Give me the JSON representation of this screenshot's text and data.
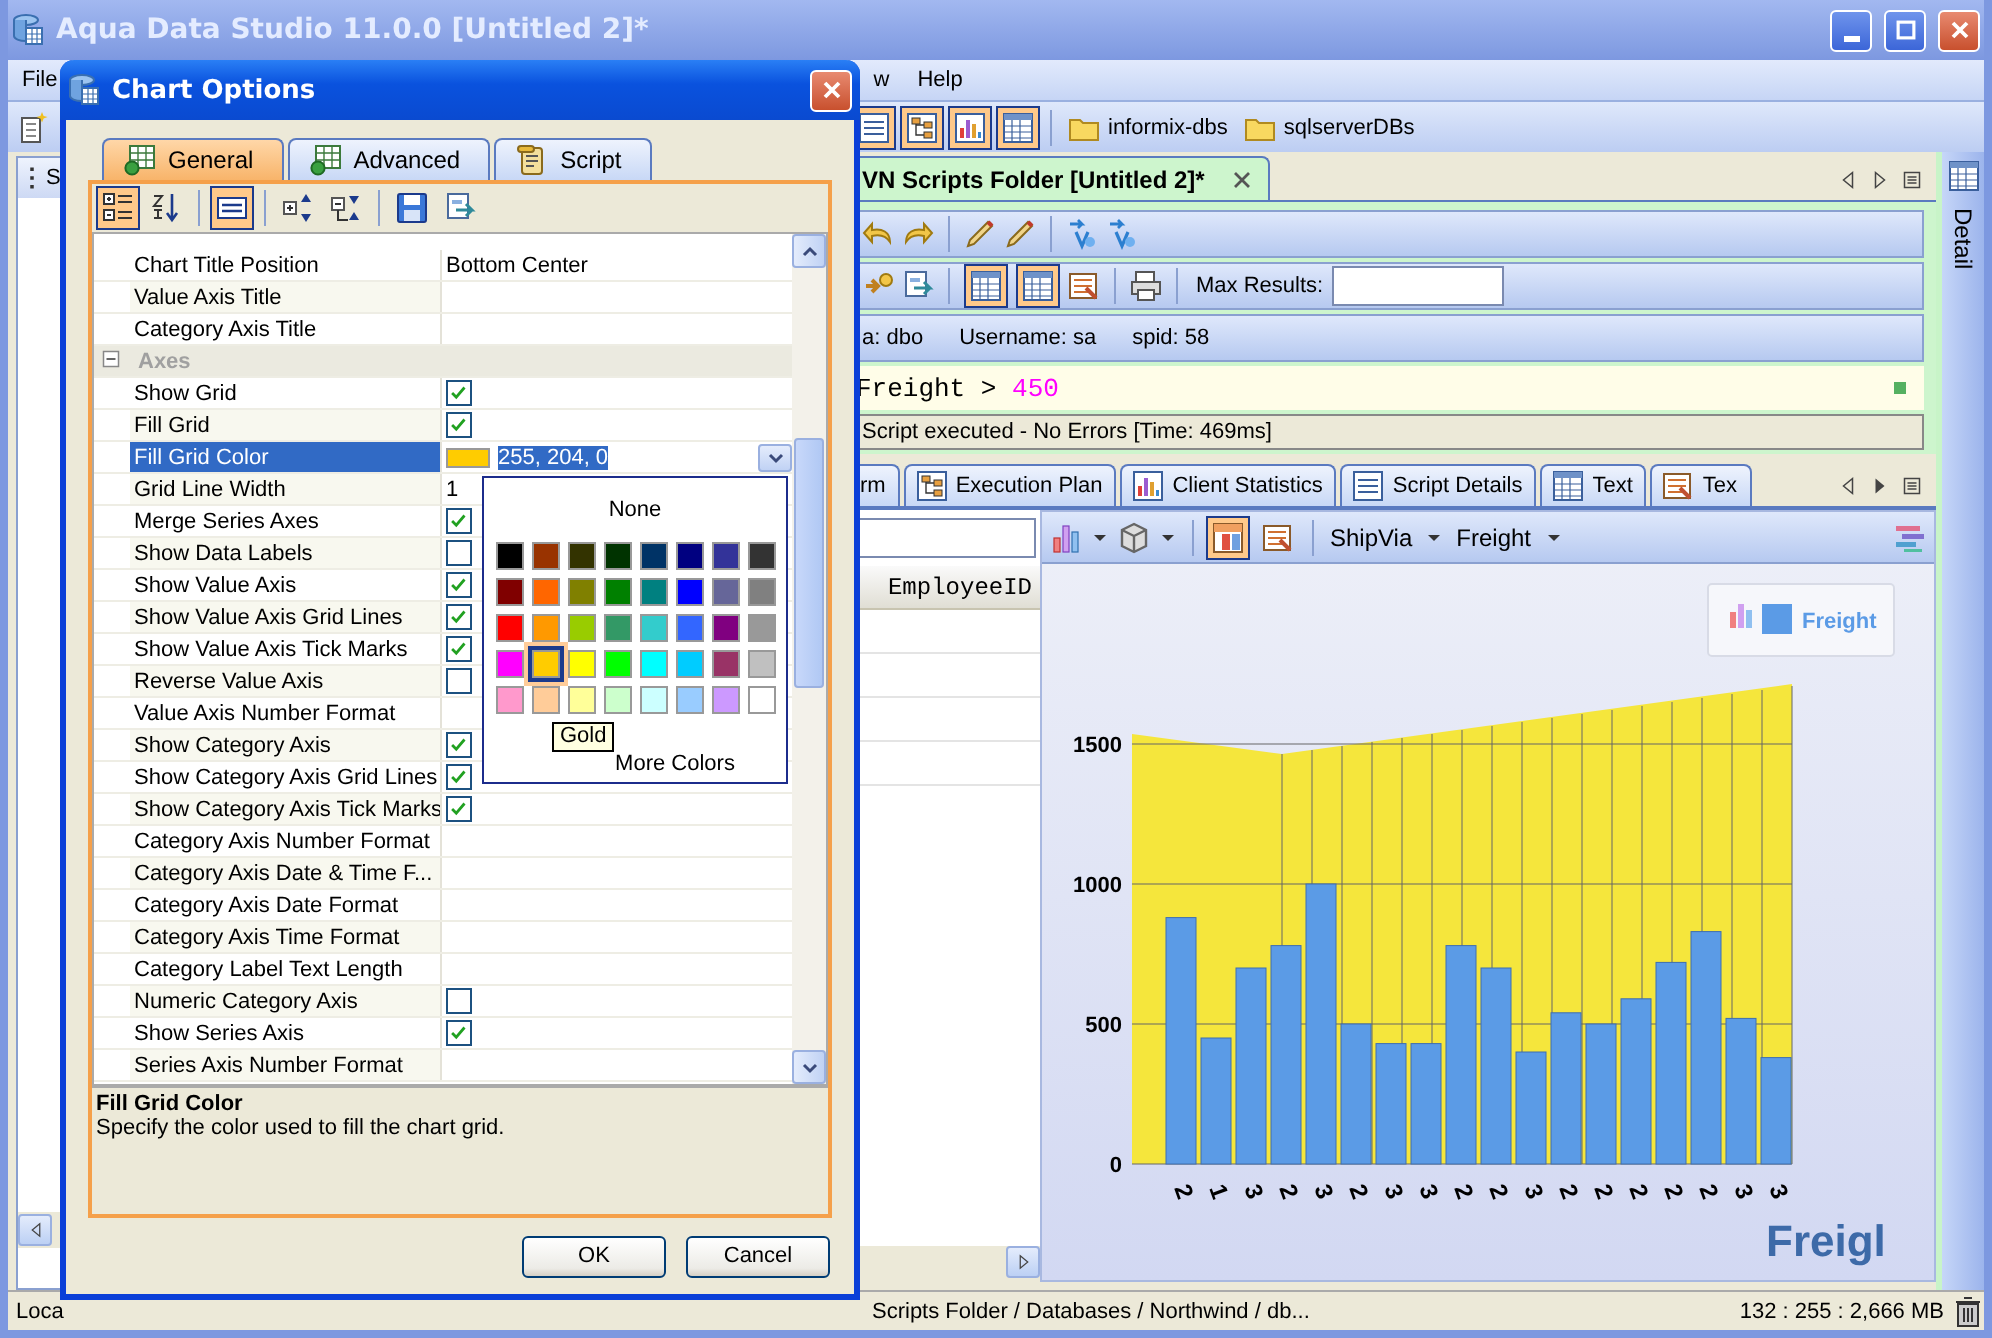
{
  "window": {
    "title": "Aqua Data Studio 11.0.0 [Untitled 2]*"
  },
  "menu": [
    "File",
    "w",
    "Help"
  ],
  "toolbar": {
    "toggles": [
      {
        "selected": true
      },
      {
        "selected": true
      },
      {
        "selected": true
      },
      {
        "selected": true
      }
    ],
    "folders": [
      "informix-dbs",
      "sqlserverDBs"
    ]
  },
  "left_panel": {
    "title": "S"
  },
  "editor": {
    "tab_title": "VN Scripts Folder [Untitled 2]*",
    "toggles": [
      {
        "selected": true
      },
      {
        "selected": true
      }
    ],
    "max_results_label": "Max Results:",
    "session": [
      {
        "label": "a:",
        "value": "dbo"
      },
      {
        "label": "Username:",
        "value": "sa"
      },
      {
        "label": "spid:",
        "value": "58"
      }
    ],
    "code": [
      {
        "kind": "plain",
        "text": "Freight > "
      },
      {
        "kind": "number",
        "text": "450"
      }
    ],
    "message": "Script executed - No Errors [Time: 469ms]"
  },
  "results": {
    "tabs": [
      {
        "label": "rm",
        "selected": false
      },
      {
        "label": "Execution Plan",
        "selected": false
      },
      {
        "label": "Client Statistics",
        "selected": false
      },
      {
        "label": "Script Details",
        "selected": false
      },
      {
        "label": "Text",
        "selected": false
      },
      {
        "label": "Tex",
        "selected": false
      }
    ],
    "grid": {
      "columns": [
        "EmployeeID"
      ]
    },
    "chart_toolbar": {
      "toggles": [
        {
          "selected": true
        },
        {
          "selected": false
        }
      ],
      "x_field": "ShipVia",
      "y_field": "Freight"
    },
    "chart": {
      "chart_data": {
        "type": "bar",
        "title": "Freigl",
        "categories": [
          "2",
          "1",
          "3",
          "2",
          "3",
          "2",
          "3",
          "3",
          "2",
          "2",
          "3",
          "2",
          "2",
          "2",
          "2",
          "2",
          "3",
          "3"
        ],
        "series": [
          {
            "name": "Freight",
            "color": "#5b9be6",
            "values": [
              880,
              450,
              700,
              780,
              1000,
              500,
              430,
              430,
              780,
              700,
              400,
              540,
              500,
              590,
              720,
              830,
              520,
              380
            ]
          }
        ],
        "grid": true,
        "ylim": [
          0,
          1500
        ],
        "yticks": [
          0,
          500,
          1000,
          1500
        ]
      }
    }
  },
  "detail_panel": {
    "label": "Detail"
  },
  "status_bar": {
    "left": "Loca",
    "path": "Scripts Folder / Databases / Northwind / db...",
    "memory": "132 : 255 : 2,666 MB"
  },
  "dialog": {
    "title": "Chart Options",
    "tabs": [
      {
        "label": "General",
        "selected": true
      },
      {
        "label": "Advanced",
        "selected": false
      },
      {
        "label": "Script",
        "selected": false
      }
    ],
    "toggles": [
      {
        "selected": true
      },
      {
        "selected": false
      },
      {
        "selected": true
      },
      {
        "selected": false
      },
      {
        "selected": false
      },
      {
        "selected": false
      },
      {
        "selected": false
      }
    ],
    "properties": [
      {
        "kind": "text",
        "name": "Chart Title Position",
        "value": "Bottom Center",
        "selected": false
      },
      {
        "kind": "text",
        "name": "Value Axis Title",
        "selected": false
      },
      {
        "kind": "text",
        "name": "Category Axis Title",
        "selected": false
      },
      {
        "kind": "group",
        "name": "Axes",
        "expanded": true
      },
      {
        "kind": "check",
        "name": "Show Grid",
        "checked": true,
        "selected": false
      },
      {
        "kind": "check",
        "name": "Fill Grid",
        "checked": true,
        "selected": false
      },
      {
        "kind": "color",
        "name": "Fill Grid Color",
        "value": "255, 204, 0",
        "color": "#ffcc00",
        "selected": true
      },
      {
        "kind": "text",
        "name": "Grid Line Width",
        "value": "1",
        "selected": false
      },
      {
        "kind": "check",
        "name": "Merge Series Axes",
        "checked": true,
        "selected": false
      },
      {
        "kind": "check",
        "name": "Show Data Labels",
        "checked": false,
        "selected": false
      },
      {
        "kind": "check",
        "name": "Show Value Axis",
        "checked": true,
        "selected": false
      },
      {
        "kind": "check",
        "name": "Show Value Axis Grid Lines",
        "checked": true,
        "selected": false
      },
      {
        "kind": "check",
        "name": "Show Value Axis Tick Marks",
        "checked": true,
        "selected": false
      },
      {
        "kind": "check",
        "name": "Reverse Value Axis",
        "checked": false,
        "selected": false
      },
      {
        "kind": "text",
        "name": "Value Axis Number Format",
        "selected": false
      },
      {
        "kind": "check",
        "name": "Show Category Axis",
        "checked": true,
        "selected": false
      },
      {
        "kind": "check",
        "name": "Show Category Axis Grid Lines",
        "checked": true,
        "selected": false
      },
      {
        "kind": "check",
        "name": "Show Category Axis Tick Marks",
        "checked": true,
        "selected": false
      },
      {
        "kind": "text",
        "name": "Category Axis Number Format",
        "selected": false
      },
      {
        "kind": "text",
        "name": "Category Axis Date & Time F...",
        "selected": false
      },
      {
        "kind": "text",
        "name": "Category Axis Date Format",
        "selected": false
      },
      {
        "kind": "text",
        "name": "Category Axis Time Format",
        "selected": false
      },
      {
        "kind": "text",
        "name": "Category Label Text Length",
        "selected": false
      },
      {
        "kind": "check",
        "name": "Numeric Category Axis",
        "checked": false,
        "selected": false
      },
      {
        "kind": "check",
        "name": "Show Series Axis",
        "checked": true,
        "selected": false
      },
      {
        "kind": "text",
        "name": "Series Axis Number Format",
        "selected": false
      }
    ],
    "color_popup": {
      "none_label": "None",
      "tooltip": "Gold",
      "more_label": "More Colors",
      "swatches": [
        {
          "color": "#000000",
          "selected": false
        },
        {
          "color": "#993300",
          "selected": false
        },
        {
          "color": "#333300",
          "selected": false
        },
        {
          "color": "#003300",
          "selected": false
        },
        {
          "color": "#003366",
          "selected": false
        },
        {
          "color": "#000080",
          "selected": false
        },
        {
          "color": "#333399",
          "selected": false
        },
        {
          "color": "#333333",
          "selected": false
        },
        {
          "color": "#800000",
          "selected": false
        },
        {
          "color": "#ff6600",
          "selected": false
        },
        {
          "color": "#808000",
          "selected": false
        },
        {
          "color": "#008000",
          "selected": false
        },
        {
          "color": "#008080",
          "selected": false
        },
        {
          "color": "#0000ff",
          "selected": false
        },
        {
          "color": "#666699",
          "selected": false
        },
        {
          "color": "#808080",
          "selected": false
        },
        {
          "color": "#ff0000",
          "selected": false
        },
        {
          "color": "#ff9900",
          "selected": false
        },
        {
          "color": "#99cc00",
          "selected": false
        },
        {
          "color": "#339966",
          "selected": false
        },
        {
          "color": "#33cccc",
          "selected": false
        },
        {
          "color": "#3366ff",
          "selected": false
        },
        {
          "color": "#800080",
          "selected": false
        },
        {
          "color": "#999999",
          "selected": false
        },
        {
          "color": "#ff00ff",
          "selected": false
        },
        {
          "color": "#ffcc00",
          "selected": true
        },
        {
          "color": "#ffff00",
          "selected": false
        },
        {
          "color": "#00ff00",
          "selected": false
        },
        {
          "color": "#00ffff",
          "selected": false
        },
        {
          "color": "#00ccff",
          "selected": false
        },
        {
          "color": "#993366",
          "selected": false
        },
        {
          "color": "#c0c0c0",
          "selected": false
        },
        {
          "color": "#ff99cc",
          "selected": false
        },
        {
          "color": "#ffcc99",
          "selected": false
        },
        {
          "color": "#ffff99",
          "selected": false
        },
        {
          "color": "#ccffcc",
          "selected": false
        },
        {
          "color": "#ccffff",
          "selected": false
        },
        {
          "color": "#99ccff",
          "selected": false
        },
        {
          "color": "#cc99ff",
          "selected": false
        },
        {
          "color": "#ffffff",
          "selected": false
        }
      ]
    },
    "description": {
      "title": "Fill Grid Color",
      "text": "Specify the color used to fill the chart grid."
    },
    "buttons": [
      "OK",
      "Cancel"
    ]
  }
}
